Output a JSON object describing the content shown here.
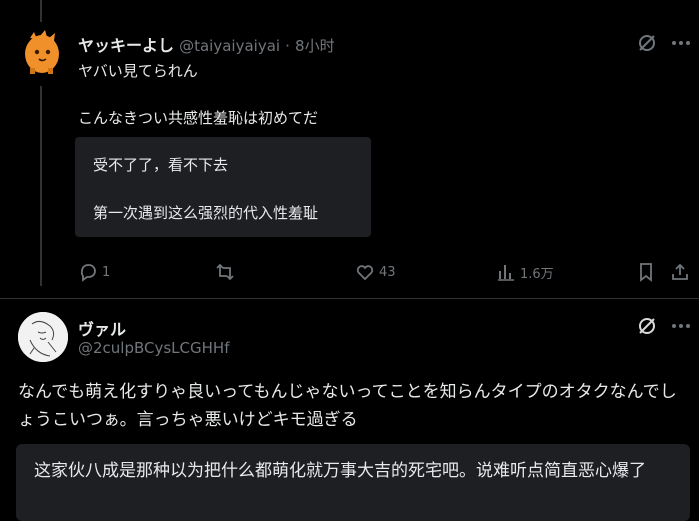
{
  "tweet1": {
    "display_name": "ヤッキーよし",
    "handle": "@taiyaiyaiyai",
    "separator": "·",
    "time": "8小时",
    "body_line1": "ヤバい見てられん",
    "body_line2": "こんなきつい共感性羞恥は初めてだ",
    "quote": {
      "line1": "受不了了，看不下去",
      "line2": "第一次遇到这么强烈的代入性羞耻"
    },
    "actions": {
      "reply_count": "1",
      "retweet_count": "",
      "like_count": "43",
      "view_count": "1.6万"
    }
  },
  "tweet2": {
    "display_name": "ヴァル",
    "handle": "@2culpBCysLCGHHf",
    "body": "なんでも萌え化すりゃ良いってもんじゃないってことを知らんタイプのオタクなんでしょうこいつぁ。言っちゃ悪いけどキモ過ぎる",
    "quote": "这家伙八成是那种以为把什么都萌化就万事大吉的死宅吧。说难听点简直恶心爆了"
  },
  "colors": {
    "background": "#000000",
    "text": "#e7e9ea",
    "muted": "#71767b",
    "quote_bg": "#1d1f23",
    "avatar1": "#f0902a"
  },
  "icons": [
    "grok-icon",
    "more-icon",
    "reply-icon",
    "retweet-icon",
    "like-icon",
    "views-icon",
    "bookmark-icon",
    "share-icon"
  ]
}
